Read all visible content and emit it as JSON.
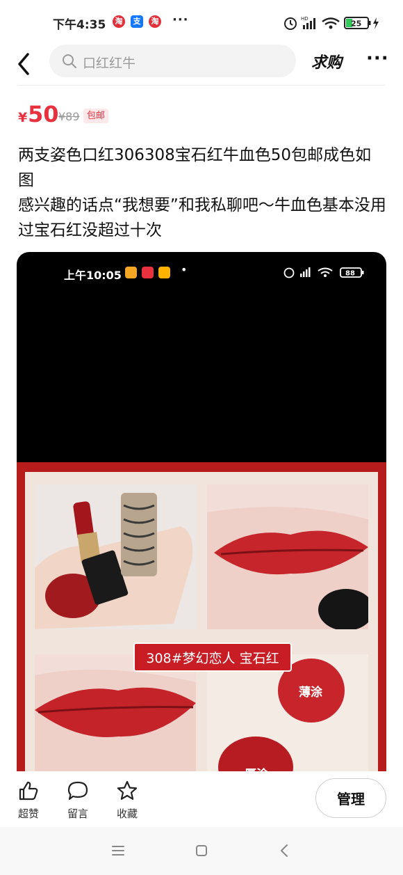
{
  "status_bar": {
    "time": "下午4:35",
    "apps": [
      "淘",
      "支",
      "淘"
    ],
    "more": "···",
    "battery": "25"
  },
  "nav": {
    "search_placeholder": "口红红牛",
    "want_label": "求购",
    "more_label": "···"
  },
  "listing": {
    "currency": "¥",
    "price": "50",
    "original_price": "¥89",
    "tag": "包邮",
    "description_line1": "两支姿色口红306308宝石红牛血色50包邮成色如图",
    "description_line2": "感兴趣的话点“我想要”和我私聊吧～牛血色基本没用过宝石红没超过十次"
  },
  "image": {
    "inner_time": "上午10:05",
    "inner_battery": "88",
    "caption": "308#梦幻恋人 宝石红",
    "swatch_thin": "薄涂",
    "swatch_thick": "厚涂"
  },
  "actions": {
    "like": "超赞",
    "comment": "留言",
    "favorite": "收藏",
    "manage": "管理"
  },
  "colors": {
    "accent": "#e8313f",
    "lipstick_red": "#b71c1c"
  }
}
